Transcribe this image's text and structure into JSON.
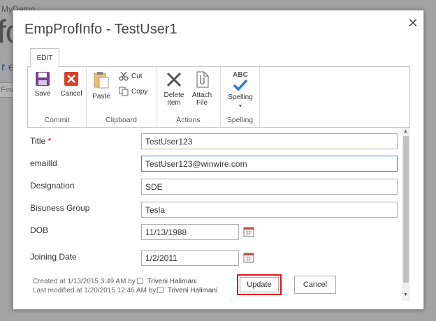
{
  "background": {
    "site_label": "MyDemo",
    "big_text": "fo",
    "link_text": "r e",
    "search_text": "Find"
  },
  "dialog": {
    "title": "EmpProfInfo - TestUser1",
    "close_glyph": "✕"
  },
  "ribbon": {
    "tab": "EDIT",
    "groups": {
      "commit": {
        "label": "Commit",
        "save": "Save",
        "cancel": "Cancel"
      },
      "clipboard": {
        "label": "Clipboard",
        "paste": "Paste",
        "cut": "Cut",
        "copy": "Copy"
      },
      "actions": {
        "label": "Actions",
        "delete_line1": "Delete",
        "delete_line2": "Item",
        "attach_line1": "Attach",
        "attach_line2": "File"
      },
      "spelling": {
        "label": "Spelling",
        "spelling": "Spelling",
        "abc": "ABC"
      }
    }
  },
  "form": {
    "fields": [
      {
        "label": "Title",
        "required_marker": "*",
        "value": "TestUser123"
      },
      {
        "label": "emailId",
        "value": "TestUser123@winwire.com"
      },
      {
        "label": "Designation",
        "value": "SDE"
      },
      {
        "label": "Bisuness Group",
        "value": "Tesla"
      },
      {
        "label": "DOB",
        "value": "11/13/1988"
      },
      {
        "label": "Joining Date",
        "value": "1/2/2011"
      }
    ],
    "created": {
      "prefix": "Created at 1/13/2015 3:49 AM  by",
      "user": "Triveni Halimani"
    },
    "modified": {
      "prefix": "Last modified at 1/20/2015 12:46 AM  by",
      "user": "Triveni Halimani"
    },
    "update_label": "Update",
    "cancel_label": "Cancel"
  },
  "colors": {
    "accent_blue": "#3b7fd6",
    "cancel_red": "#d7402b",
    "save_purple": "#7b3f9c",
    "highlight_red": "#e0121d"
  }
}
